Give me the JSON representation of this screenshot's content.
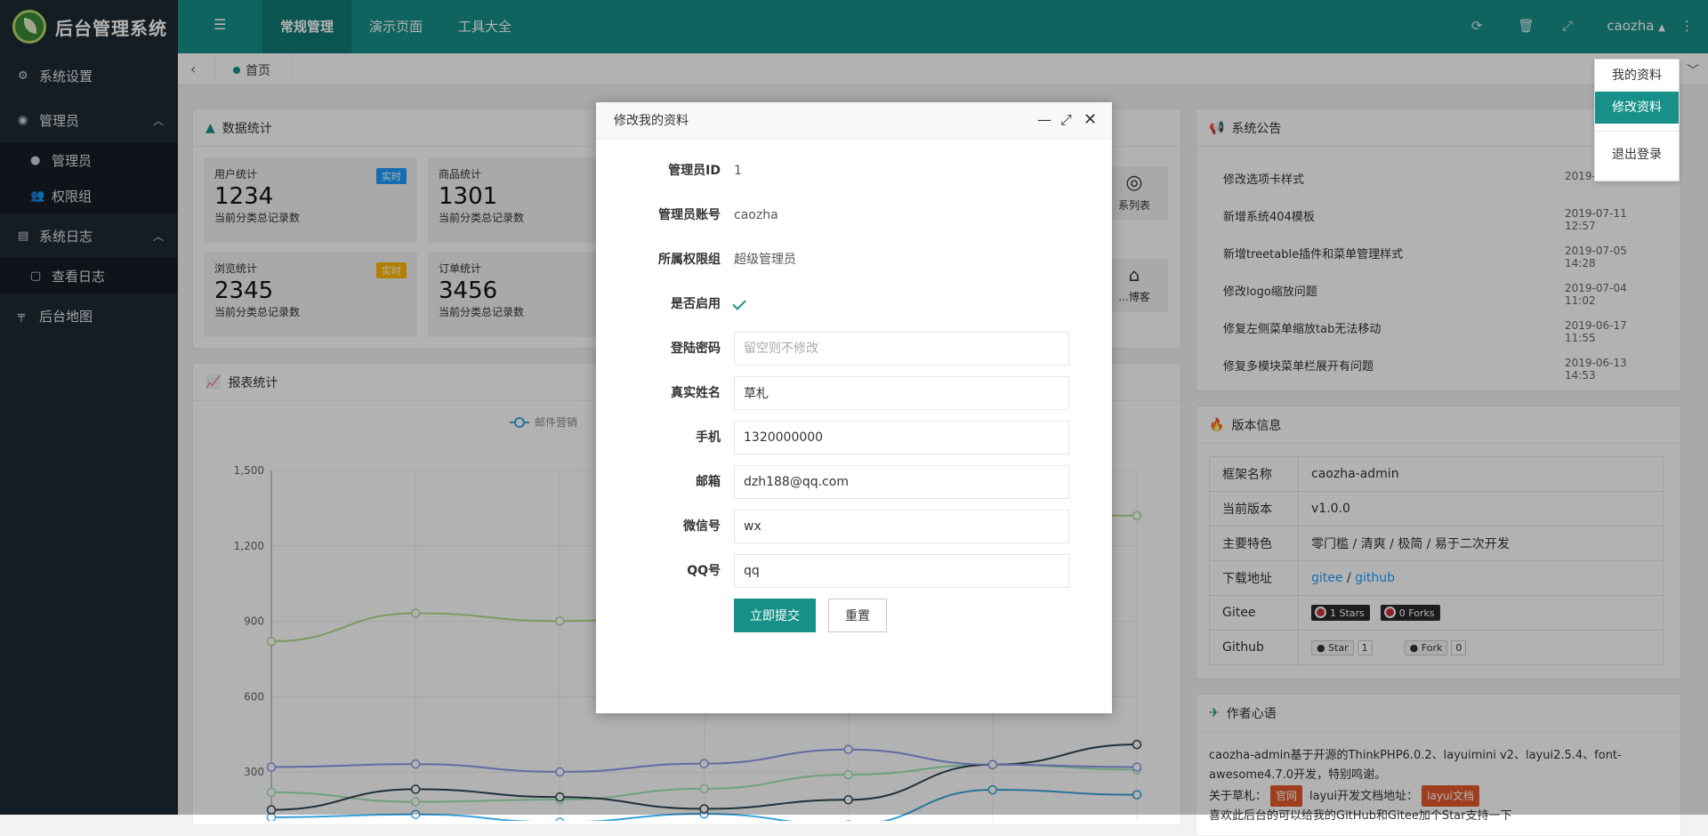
{
  "app": {
    "title": "后台管理系统"
  },
  "header": {
    "tabs": [
      "常规管理",
      "演示页面",
      "工具大全"
    ],
    "user": "caozha"
  },
  "sidebar": {
    "items": [
      {
        "label": "系统设置",
        "icon": "gears-icon"
      },
      {
        "label": "管理员",
        "icon": "user-circle-icon",
        "expanded": true,
        "children": [
          {
            "label": "管理员",
            "icon": "user-icon"
          },
          {
            "label": "权限组",
            "icon": "users-icon"
          }
        ]
      },
      {
        "label": "系统日志",
        "icon": "file-icon",
        "expanded": true,
        "children": [
          {
            "label": "查看日志",
            "icon": "doc-icon"
          }
        ]
      },
      {
        "label": "后台地图",
        "icon": "signs-icon"
      }
    ]
  },
  "tabbar": {
    "home": "首页"
  },
  "stats": {
    "title": "数据统计",
    "cards": [
      {
        "name": "用户统计",
        "value": "1234",
        "desc": "当前分类总记录数",
        "tag": "实时",
        "tag_color": "#1e9fff"
      },
      {
        "name": "商品统计",
        "value": "1301",
        "desc": "当前分类总记录数",
        "tag": "",
        "tag_color": ""
      },
      {
        "name": "浏览统计",
        "value": "2345",
        "desc": "当前分类总记录数",
        "tag": "实时",
        "tag_color": "#ffb800"
      },
      {
        "name": "订单统计",
        "value": "3456",
        "desc": "当前分类总记录数",
        "tag": "",
        "tag_color": ""
      }
    ],
    "quick": [
      "系列表",
      "...博客"
    ]
  },
  "report": {
    "title": "报表统计",
    "legend": [
      "邮件营销"
    ]
  },
  "chart_data": {
    "type": "line",
    "title": "",
    "ylim": [
      0,
      1500
    ],
    "yticks": [
      300,
      600,
      900,
      1200,
      1500
    ],
    "grid": true,
    "legend_position": "top-center",
    "x": [
      0,
      1,
      2,
      3,
      4,
      5,
      6
    ],
    "series": [
      {
        "name": "邮件营销",
        "color": "#37a2da",
        "values": [
          120,
          132,
          101,
          134,
          90,
          230,
          210
        ]
      },
      {
        "name": "",
        "color": "#9fe6b8",
        "values": [
          220,
          182,
          191,
          234,
          290,
          330,
          310
        ]
      },
      {
        "name": "",
        "color": "#2f4554",
        "values": [
          150,
          232,
          201,
          154,
          190,
          330,
          410
        ]
      },
      {
        "name": "",
        "color": "#8d98e8",
        "values": [
          320,
          332,
          301,
          334,
          390,
          330,
          320
        ]
      },
      {
        "name": "",
        "color": "#b4dc8a",
        "values": [
          820,
          932,
          901,
          934,
          1290,
          1330,
          1320
        ]
      }
    ]
  },
  "notice": {
    "title": "系统公告",
    "items": [
      {
        "text": "修改选项卡样式",
        "date": "2019-"
      },
      {
        "text": "新增系统404模板",
        "date": "2019-07-11 12:57"
      },
      {
        "text": "新增treetable插件和菜单管理样式",
        "date": "2019-07-05 14:28"
      },
      {
        "text": "修改logo缩放问题",
        "date": "2019-07-04 11:02"
      },
      {
        "text": "修复左侧菜单缩放tab无法移动",
        "date": "2019-06-17 11:55"
      },
      {
        "text": "修复多模块菜单栏展开有问题",
        "date": "2019-06-13 14:53"
      }
    ]
  },
  "version": {
    "title": "版本信息",
    "rows": [
      {
        "k": "框架名称",
        "v": "caozha-admin"
      },
      {
        "k": "当前版本",
        "v": "v1.0.0"
      },
      {
        "k": "主要特色",
        "v": "零门槛 / 清爽 / 极简 / 易于二次开发"
      },
      {
        "k": "下载地址",
        "v": ""
      },
      {
        "k": "Gitee",
        "v": ""
      },
      {
        "k": "Github",
        "v": ""
      }
    ],
    "download_gitee": "gitee",
    "download_sep": " / ",
    "download_github": "github",
    "gitee_stars": "1 Stars",
    "gitee_forks": "0 Forks",
    "github_star": "Star",
    "github_star_count": "1",
    "github_fork": "Fork",
    "github_fork_count": "0"
  },
  "author": {
    "title": "作者心语",
    "line1": "caozha-admin基于开源的ThinkPHP6.0.2、layuimini v2、layui2.5.4、font-awesome4.7.0开发，特别鸣谢。",
    "line2_prefix": "关于草札：",
    "tag1": "官网",
    "line2_mid": "layui开发文档地址：",
    "tag2": "layui文档",
    "line3": "喜欢此后台的可以给我的GitHub和Gitee加个Star支持一下"
  },
  "dropdown": {
    "items": [
      "我的资料",
      "修改资料",
      "退出登录"
    ],
    "active": 1
  },
  "modal": {
    "title": "修改我的资料",
    "fields": {
      "id_label": "管理员ID",
      "id_value": "1",
      "account_label": "管理员账号",
      "account_value": "caozha",
      "group_label": "所属权限组",
      "group_value": "超级管理员",
      "enabled_label": "是否启用",
      "password_label": "登陆密码",
      "password_placeholder": "留空则不修改",
      "name_label": "真实姓名",
      "name_value": "草札",
      "phone_label": "手机",
      "phone_value": "1320000000",
      "email_label": "邮箱",
      "email_value": "dzh188@qq.com",
      "wechat_label": "微信号",
      "wechat_value": "wx",
      "qq_label": "QQ号",
      "qq_value": "qq"
    },
    "submit": "立即提交",
    "reset": "重置"
  }
}
